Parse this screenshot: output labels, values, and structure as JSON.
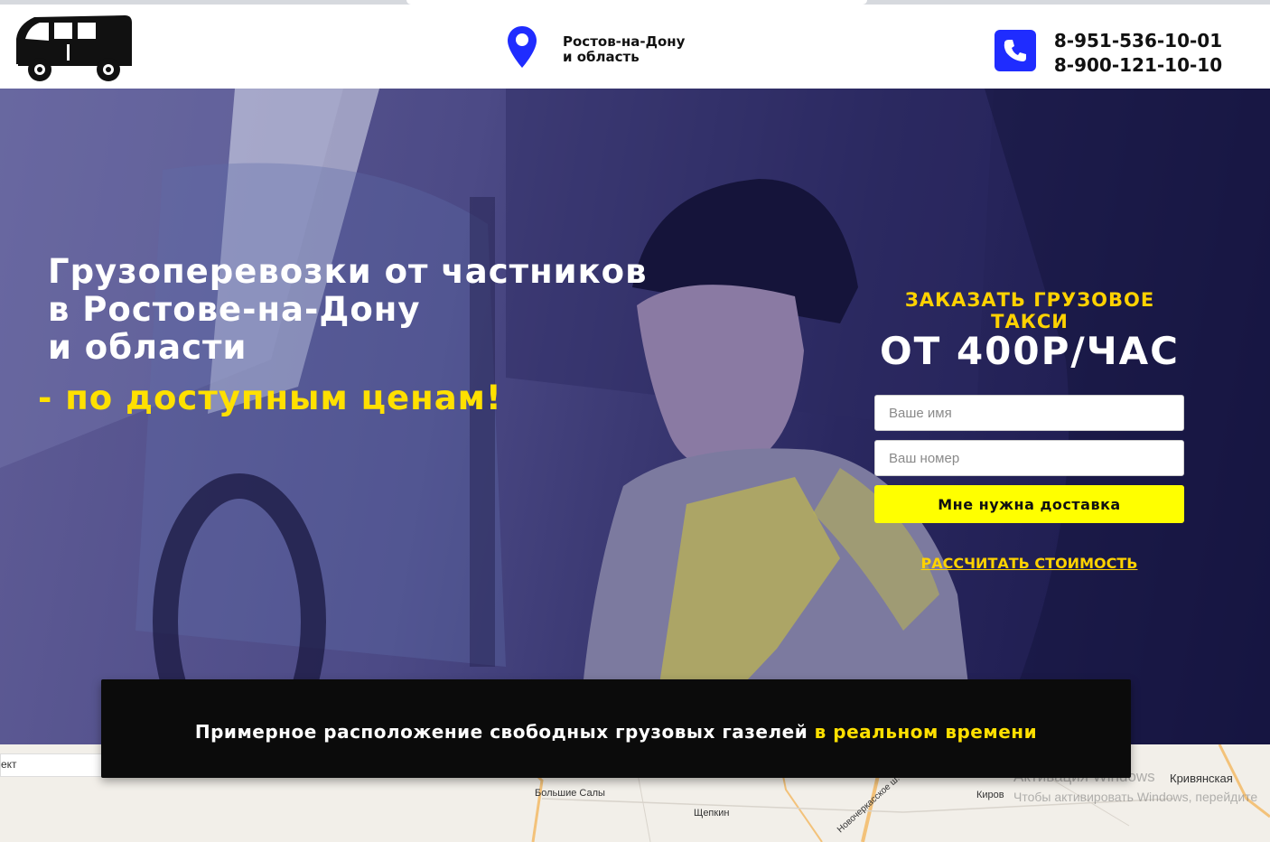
{
  "header": {
    "location_line1": "Ростов-на-Дону",
    "location_line2": "и область",
    "phone1": "8-951-536-10-01",
    "phone2": "8-900-121-10-10"
  },
  "hero": {
    "title_line1": "Грузоперевозки от частников",
    "title_line2": "в Ростове-на-Дону",
    "title_line3": "и области",
    "subtitle": "- по доступным ценам!"
  },
  "order_form": {
    "title": "ЗАКАЗАТЬ ГРУЗОВОЕ ТАКСИ",
    "price": "ОТ 400Р/ЧАС",
    "name_placeholder": "Ваше имя",
    "phone_placeholder": "Ваш номер",
    "submit_label": "Мне нужна доставка",
    "calc_link": "РАССЧИТАТЬ СТОИМОСТЬ"
  },
  "banner": {
    "text_main": "Примерное расположение свободных грузовых газелей ",
    "text_highlight": "в реальном времени"
  },
  "map": {
    "search_partial": "ект",
    "labels": [
      "Большие Салы",
      "Щепкин",
      "Новочеркасское ш.",
      "Киров",
      "Кривянская"
    ]
  },
  "watermark": {
    "line1": "Активация Windows",
    "line2": "Чтобы активировать Windows, перейдите"
  },
  "colors": {
    "accent_yellow": "#ffe000",
    "phone_blue": "#1f2cff",
    "hero_navy": "#2a2860"
  }
}
